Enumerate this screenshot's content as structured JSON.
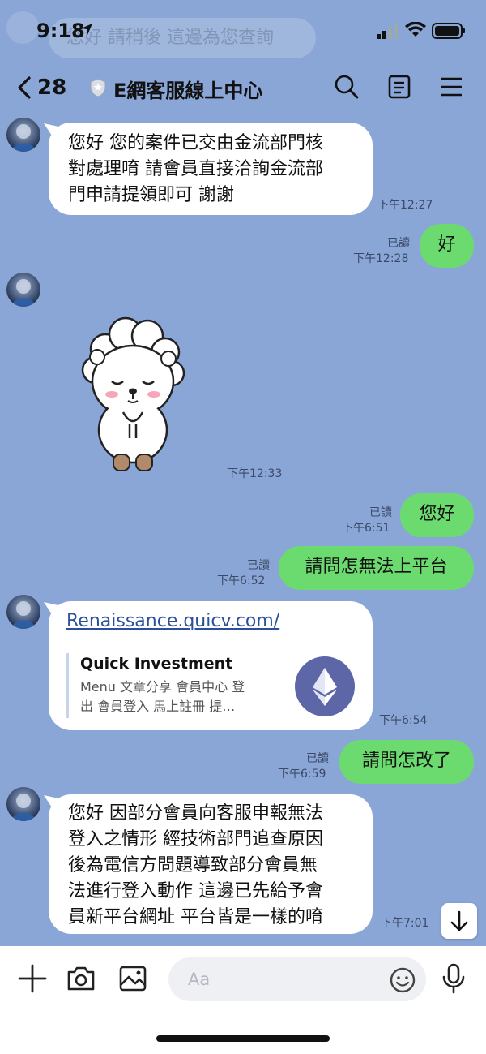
{
  "status": {
    "time": "9:18",
    "ghost_banner": "您好 請稍後 這邊為您查詢"
  },
  "header": {
    "back_count": "28",
    "title": "E網客服線上中心"
  },
  "messages": {
    "m1": {
      "text_lines": [
        "您好 您的案件已交由金流部門核",
        "對處理唷 請會員直接洽詢金流部",
        "門申請提領即可 謝謝"
      ],
      "time": "下午12:27"
    },
    "m2": {
      "text": "好",
      "read": "已讀",
      "time": "下午12:28"
    },
    "m3": {
      "time": "下午12:33"
    },
    "m4": {
      "text": "您好",
      "read": "已讀",
      "time": "下午6:51"
    },
    "m5": {
      "text": "請問怎無法上平台",
      "read": "已讀",
      "time": "下午6:52"
    },
    "m6": {
      "url": "Renaissance.quicv.com/",
      "preview_title": "Quick Investment",
      "preview_desc_lines": [
        "Menu 文章分享 會員中心 登",
        "出 會員登入 馬上註冊 提…"
      ],
      "time": "下午6:54"
    },
    "m7": {
      "text": "請問怎改了",
      "read": "已讀",
      "time": "下午6:59"
    },
    "m8": {
      "text_lines": [
        "您好 因部分會員向客服申報無法",
        "登入之情形 經技術部門追查原因",
        "後為電信方問題導致部分會員無",
        "法進行登入動作 這邊已先給予會",
        "員新平台網址 平台皆是一樣的唷"
      ],
      "time": "下午7:01"
    }
  },
  "input": {
    "placeholder": "Aa"
  },
  "colors": {
    "background": "#8aa6d6",
    "outgoing_bubble": "#6bdb6f",
    "incoming_bubble": "#ffffff",
    "link": "#2a4f9d"
  },
  "icons": [
    "back-chevron-icon",
    "shield-icon",
    "search-icon",
    "notes-icon",
    "menu-icon",
    "plus-icon",
    "camera-icon",
    "image-icon",
    "emoji-icon",
    "microphone-icon",
    "arrow-down-icon",
    "ethereum-logo-icon"
  ]
}
